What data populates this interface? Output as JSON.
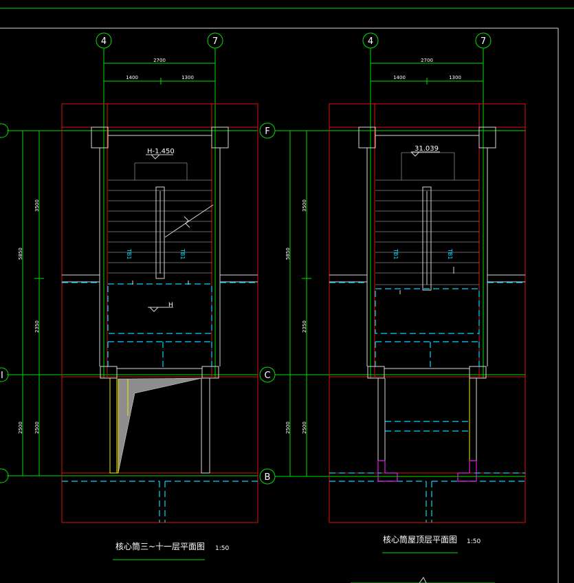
{
  "axes": {
    "col_left": "4",
    "col_right": "7",
    "row_top": "F",
    "row_mid": "C",
    "row_bot": "B",
    "row_mid_partial": "I"
  },
  "dims": {
    "total_width": "2700",
    "left_width": "1400",
    "right_width": "1300",
    "total_height": "5850",
    "stair_height": "3500",
    "lobby_height": "2350",
    "lower_height": "2500"
  },
  "left_plan": {
    "elevation": "H-1.450",
    "landing_mark": "H",
    "stair_up": "TB1",
    "stair_down": "TB1",
    "title": "核心筒三~十一层平面图",
    "scale": "1:50"
  },
  "right_plan": {
    "elevation": "31.039",
    "stair_up": "TB1",
    "stair_down": "TB1",
    "title": "核心筒屋顶层平面图",
    "scale": "1:50"
  }
}
